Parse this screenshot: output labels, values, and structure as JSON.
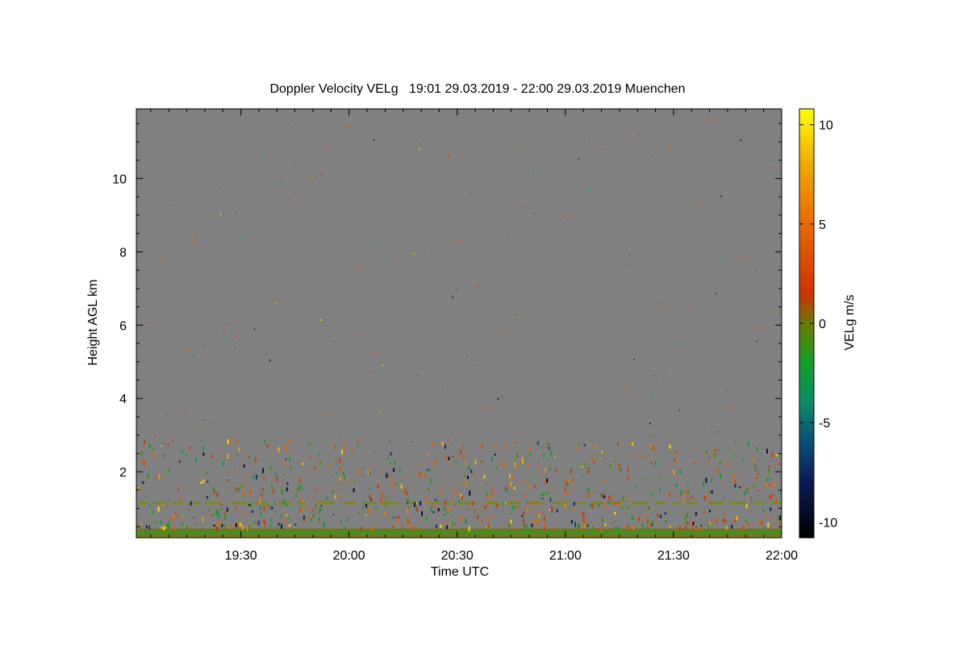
{
  "chart_data": {
    "type": "heatmap",
    "title": "Doppler Velocity VELg   19:01 29.03.2019 - 22:00 29.03.2019 Muenchen",
    "xlabel": "Time UTC",
    "ylabel": "Height AGL km",
    "colorbar_label": "VELg m/s",
    "x_start": "19:01",
    "x_end": "22:00",
    "xlim_minutes_utc": [
      1141,
      1320
    ],
    "x_ticks": [
      {
        "label": "19:30",
        "minute": 1170
      },
      {
        "label": "20:00",
        "minute": 1200
      },
      {
        "label": "20:30",
        "minute": 1230
      },
      {
        "label": "21:00",
        "minute": 1260
      },
      {
        "label": "21:30",
        "minute": 1290
      },
      {
        "label": "22:00",
        "minute": 1320
      }
    ],
    "ylim": [
      0.2,
      11.9
    ],
    "y_ticks": [
      2,
      4,
      6,
      8,
      10
    ],
    "colorbar_range": [
      -10.8,
      10.8
    ],
    "colorbar_ticks": [
      -10,
      -5,
      0,
      5,
      10
    ],
    "colormap": [
      {
        "v": -10.8,
        "c": "#000000"
      },
      {
        "v": -8.0,
        "c": "#0b1a55"
      },
      {
        "v": -6.0,
        "c": "#0b4e78"
      },
      {
        "v": -4.0,
        "c": "#0a8a66"
      },
      {
        "v": -2.0,
        "c": "#11a02a"
      },
      {
        "v": 0.0,
        "c": "#6b7a00"
      },
      {
        "v": 1.5,
        "c": "#cc3300"
      },
      {
        "v": 5.0,
        "c": "#e86a00"
      },
      {
        "v": 8.0,
        "c": "#f0a800"
      },
      {
        "v": 10.8,
        "c": "#ffff00"
      }
    ],
    "background_color": "#808080",
    "grid": false,
    "features": [
      {
        "name": "near-surface layer",
        "height_km": [
          0.22,
          0.45
        ],
        "velocity_ms": 0,
        "continuous": true
      },
      {
        "name": "dashed layer",
        "height_km": 1.15,
        "velocity_ms": 0,
        "continuous": false
      }
    ]
  }
}
